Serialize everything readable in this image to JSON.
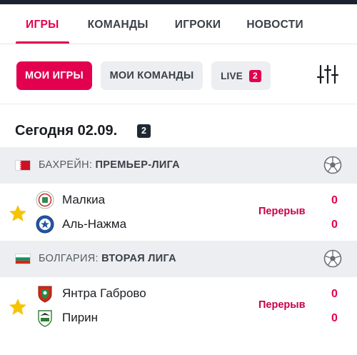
{
  "tabs": [
    {
      "label": "ИГРЫ",
      "active": true
    },
    {
      "label": "КОМАНДЫ"
    },
    {
      "label": "ИГРОКИ"
    },
    {
      "label": "НОВОСТИ"
    }
  ],
  "filters": {
    "my_games": "МОИ ИГРЫ",
    "my_teams": "МОИ КОМАНДЫ",
    "live_label": "LIVE",
    "live_count": "2",
    "filter_icon": "equalizer-sliders-icon"
  },
  "date_header": {
    "title": "Сегодня 02.09.",
    "count": "2"
  },
  "colors": {
    "accent": "#e2004f",
    "panel": "#eceef1",
    "dark_badge": "#1f2933",
    "star": "#f6c400"
  },
  "leagues": [
    {
      "country": "БАХРЕЙН: ",
      "name": "ПРЕМЬЕР-ЛИГА",
      "flag_icon": "bahrain-flag-icon",
      "sport_icon": "soccer-ball-icon",
      "match": {
        "favorite_icon": "star-icon",
        "home": "Малкиа",
        "away": "Аль-Нажма",
        "status": "Перерыв",
        "home_score": "0",
        "away_score": "0"
      }
    },
    {
      "country": "БОЛГАРИЯ: ",
      "name": "ВТОРАЯ ЛИГА",
      "flag_icon": "bulgaria-flag-icon",
      "sport_icon": "soccer-ball-icon",
      "match": {
        "favorite_icon": "star-icon",
        "home": "Янтра Габрово",
        "away": "Пирин",
        "status": "Перерыв",
        "home_score": "0",
        "away_score": "0"
      }
    }
  ]
}
